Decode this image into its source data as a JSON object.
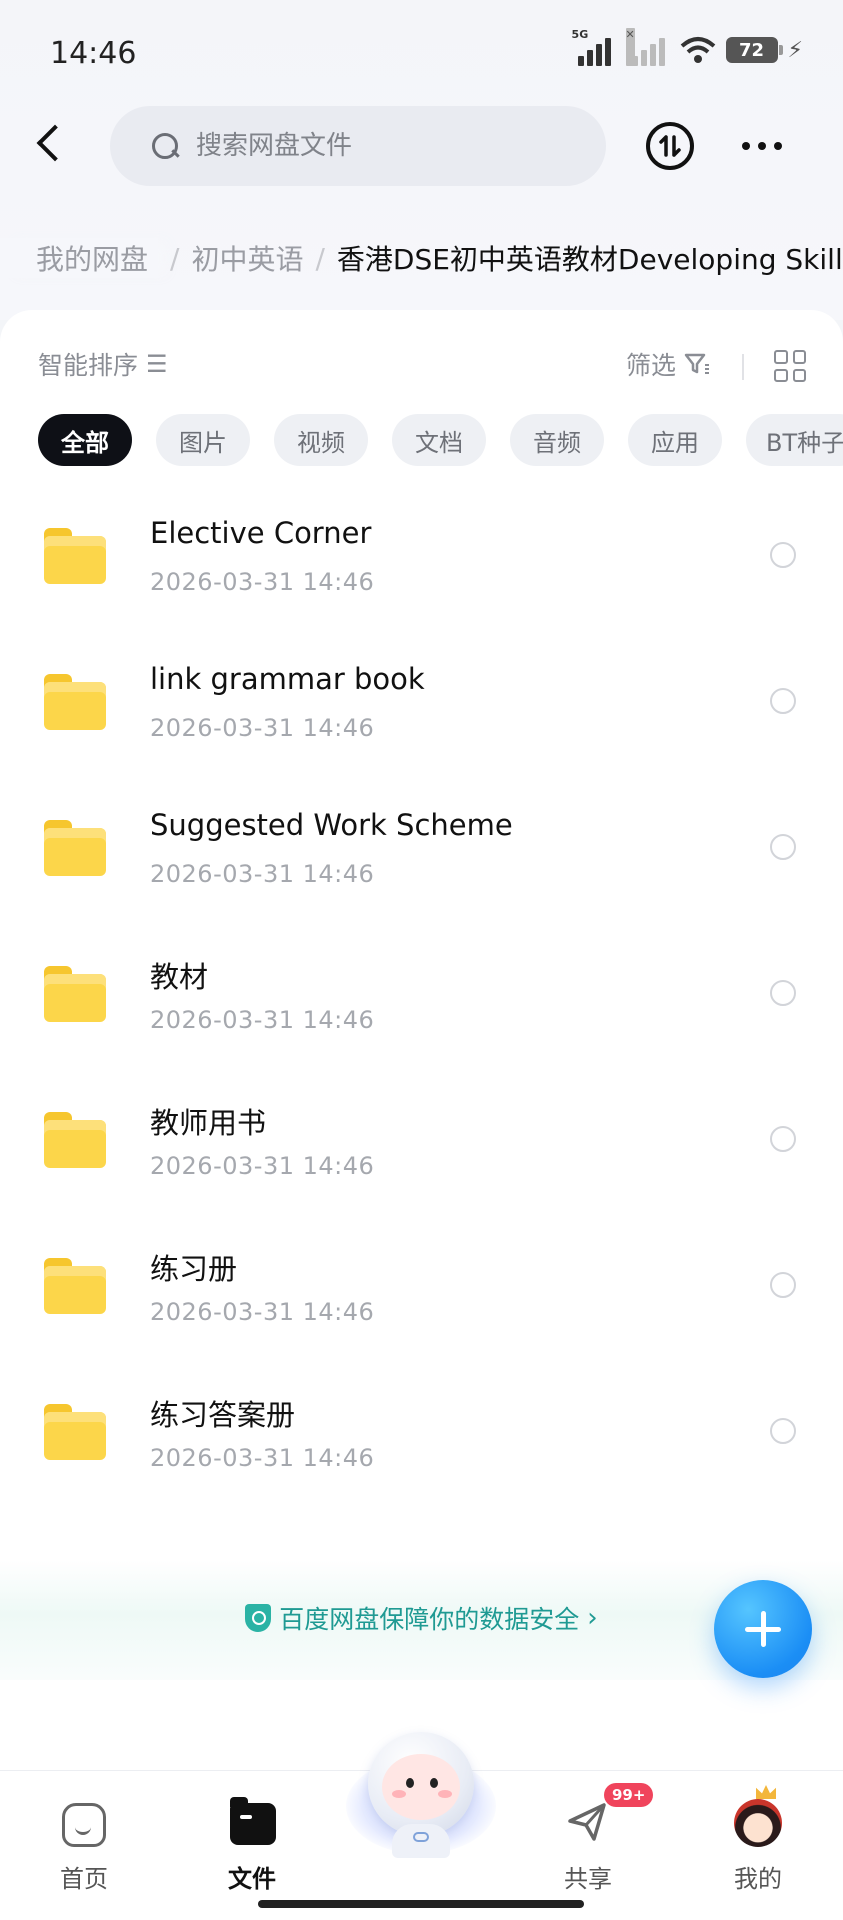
{
  "status_bar": {
    "time": "14:46",
    "network": "5G",
    "battery": "72"
  },
  "header": {
    "search_placeholder": "搜索网盘文件",
    "transfer_icon": "transfer-list-icon",
    "more_icon": "more-icon"
  },
  "breadcrumb": {
    "items": [
      "我的网盘",
      "初中英语",
      "香港DSE初中英语教材Developing Skills"
    ]
  },
  "toolbar": {
    "sort_label": "智能排序",
    "filter_label": "筛选"
  },
  "categories": [
    "全部",
    "图片",
    "视频",
    "文档",
    "音频",
    "应用",
    "BT种子"
  ],
  "files": [
    {
      "name": "Elective Corner",
      "date": "2026-03-31  14:46"
    },
    {
      "name": "link grammar book",
      "date": "2026-03-31  14:46"
    },
    {
      "name": "Suggested Work Scheme",
      "date": "2026-03-31  14:46"
    },
    {
      "name": "教材",
      "date": "2026-03-31  14:46"
    },
    {
      "name": "教师用书",
      "date": "2026-03-31  14:46"
    },
    {
      "name": "练习册",
      "date": "2026-03-31  14:46"
    },
    {
      "name": "练习答案册",
      "date": "2026-03-31  14:46"
    }
  ],
  "security_notice": "百度网盘保障你的数据安全",
  "bottom_nav": {
    "home": "首页",
    "files": "文件",
    "share": "共享",
    "share_badge": "99+",
    "me": "我的"
  },
  "colors": {
    "accent_blue": "#1b8ef5",
    "security_teal": "#1f9a93",
    "folder_yellow": "#fcd64a",
    "badge_red": "#f0445c"
  }
}
